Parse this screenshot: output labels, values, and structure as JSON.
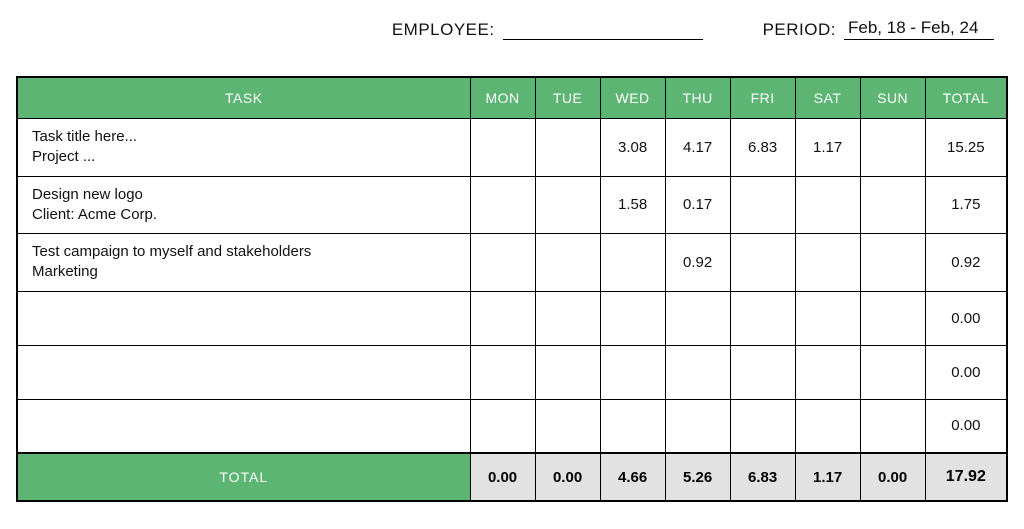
{
  "fields": {
    "employee_label": "EMPLOYEE:",
    "employee_value": "",
    "period_label": "PERIOD:",
    "period_value": "Feb, 18 - Feb, 24"
  },
  "headers": {
    "task": "TASK",
    "days": [
      "MON",
      "TUE",
      "WED",
      "THU",
      "FRI",
      "SAT",
      "SUN"
    ],
    "total": "TOTAL"
  },
  "rows": [
    {
      "title": "Task title here...",
      "sub": "Project ...",
      "cells": [
        "",
        "",
        "3.08",
        "4.17",
        "6.83",
        "1.17",
        ""
      ],
      "total": "15.25"
    },
    {
      "title": "Design new logo",
      "sub": "Client: Acme Corp.",
      "cells": [
        "",
        "",
        "1.58",
        "0.17",
        "",
        "",
        ""
      ],
      "total": "1.75"
    },
    {
      "title": "Test campaign to myself and stakeholders",
      "sub": "Marketing",
      "cells": [
        "",
        "",
        "",
        "0.92",
        "",
        "",
        ""
      ],
      "total": "0.92"
    },
    {
      "title": "",
      "sub": "",
      "cells": [
        "",
        "",
        "",
        "",
        "",
        "",
        ""
      ],
      "total": "0.00"
    },
    {
      "title": "",
      "sub": "",
      "cells": [
        "",
        "",
        "",
        "",
        "",
        "",
        ""
      ],
      "total": "0.00"
    },
    {
      "title": "",
      "sub": "",
      "cells": [
        "",
        "",
        "",
        "",
        "",
        "",
        ""
      ],
      "total": "0.00"
    }
  ],
  "footer": {
    "label": "TOTAL",
    "cells": [
      "0.00",
      "0.00",
      "4.66",
      "5.26",
      "6.83",
      "1.17",
      "0.00"
    ],
    "grand": "17.92"
  },
  "colors": {
    "green": "#5cb573",
    "grey": "#e2e2e2"
  }
}
